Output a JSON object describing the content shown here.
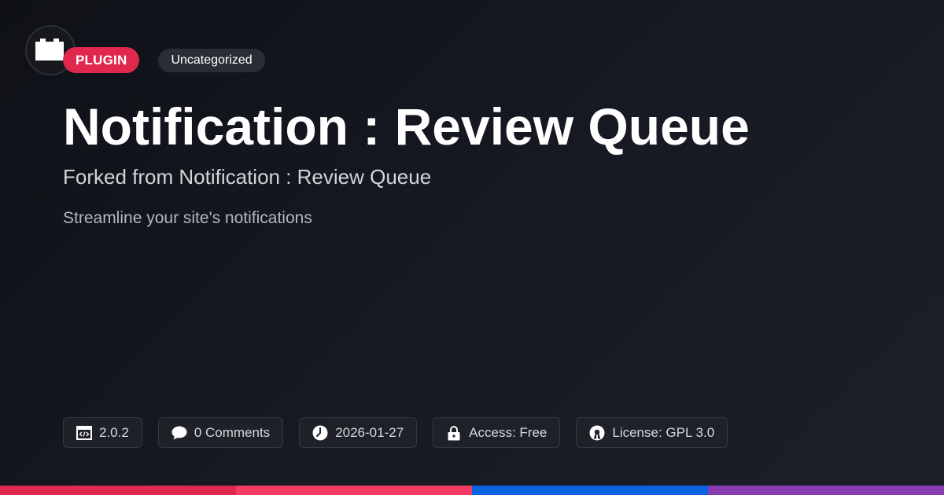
{
  "logo": {
    "icon": "plugin-block-icon"
  },
  "badges": {
    "type": "PLUGIN",
    "category": "Uncategorized"
  },
  "title": "Notification : Review Queue",
  "subtitle": "Forked from Notification : Review Queue",
  "description": "Streamline your site's notifications",
  "meta": {
    "version": "2.0.2",
    "comments": "0 Comments",
    "date": "2026-01-27",
    "access": "Access: Free",
    "license": "License: GPL 3.0"
  },
  "colors": {
    "plugin_badge": "#e0284f",
    "bar": [
      "#e0284f",
      "#f43b66",
      "#0a63e0",
      "#8a3db0"
    ]
  }
}
